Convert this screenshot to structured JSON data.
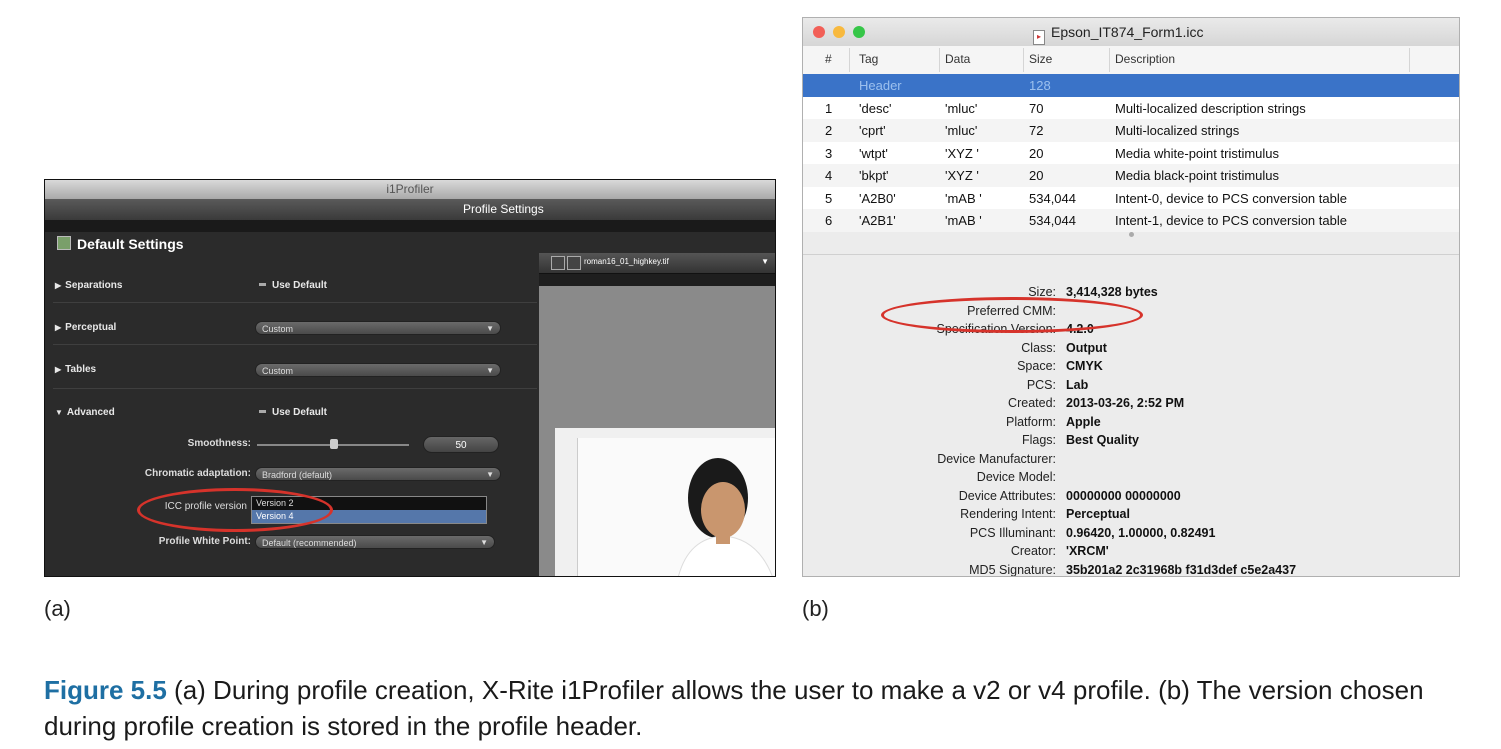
{
  "panel_a": {
    "window_title": "i1Profiler",
    "subheader": "Profile Settings",
    "section_title": "Default Settings",
    "rows": {
      "separations": {
        "label": "Separations",
        "control": "Use Default"
      },
      "perceptual": {
        "label": "Perceptual",
        "value": "Custom"
      },
      "tables": {
        "label": "Tables",
        "value": "Custom"
      },
      "advanced": {
        "label": "Advanced",
        "control": "Use Default"
      }
    },
    "smoothness": {
      "label": "Smoothness:",
      "value": "50"
    },
    "chromatic": {
      "label": "Chromatic adaptation:",
      "value": "Bradford (default)"
    },
    "icc_version": {
      "label": "ICC profile version",
      "options": [
        "Version 2",
        "Version 4"
      ],
      "selected": "Version 4"
    },
    "white_point": {
      "label": "Profile White Point:",
      "value": "Default (recommended)"
    },
    "preview_file": "roman16_01_highkey.tif",
    "letter": "(a)"
  },
  "panel_b": {
    "window_title": "Epson_IT874_Form1.icc",
    "columns": [
      "#",
      "Tag",
      "Data",
      "Size",
      "Description"
    ],
    "rows": [
      {
        "n": "",
        "tag": "Header",
        "data": "",
        "size": "128",
        "desc": ""
      },
      {
        "n": "1",
        "tag": "'desc'",
        "data": "'mluc'",
        "size": "70",
        "desc": "Multi-localized description strings"
      },
      {
        "n": "2",
        "tag": "'cprt'",
        "data": "'mluc'",
        "size": "72",
        "desc": "Multi-localized strings"
      },
      {
        "n": "3",
        "tag": "'wtpt'",
        "data": "'XYZ '",
        "size": "20",
        "desc": "Media white-point tristimulus"
      },
      {
        "n": "4",
        "tag": "'bkpt'",
        "data": "'XYZ '",
        "size": "20",
        "desc": "Media black-point tristimulus"
      },
      {
        "n": "5",
        "tag": "'A2B0'",
        "data": "'mAB '",
        "size": "534,044",
        "desc": "Intent-0, device to PCS conversion table"
      },
      {
        "n": "6",
        "tag": "'A2B1'",
        "data": "'mAB '",
        "size": "534,044",
        "desc": "Intent-1, device to PCS conversion table"
      }
    ],
    "info": [
      {
        "k": "Size:",
        "v": "3,414,328 bytes"
      },
      {
        "k": "Preferred CMM:",
        "v": ""
      },
      {
        "k": "Specification Version:",
        "v": "4.2.0"
      },
      {
        "k": "Class:",
        "v": "Output"
      },
      {
        "k": "Space:",
        "v": "CMYK"
      },
      {
        "k": "PCS:",
        "v": "Lab"
      },
      {
        "k": "Created:",
        "v": "2013-03-26, 2:52 PM"
      },
      {
        "k": "Platform:",
        "v": "Apple"
      },
      {
        "k": "Flags:",
        "v": "Best Quality"
      },
      {
        "k": "Device Manufacturer:",
        "v": ""
      },
      {
        "k": "Device Model:",
        "v": ""
      },
      {
        "k": "Device Attributes:",
        "v": "00000000 00000000"
      },
      {
        "k": "Rendering Intent:",
        "v": "Perceptual"
      },
      {
        "k": "PCS Illuminant:",
        "v": "0.96420, 1.00000, 0.82491"
      },
      {
        "k": "Creator:",
        "v": "'XRCM'"
      },
      {
        "k": "MD5 Signature:",
        "v": "35b201a2 2c31968b f31d3def c5e2a437"
      }
    ],
    "letter": "(b)"
  },
  "caption": {
    "figure": "Figure 5.5",
    "text": "  (a) During profile creation, X-Rite i1Profiler allows the user to make a v2 or v4 profile. (b) The version chosen during profile creation is stored in the profile header."
  },
  "colors": {
    "highlight_circle": "#d6332b",
    "selection_blue": "#3a73c8",
    "caption_accent": "#1e6fa3"
  }
}
